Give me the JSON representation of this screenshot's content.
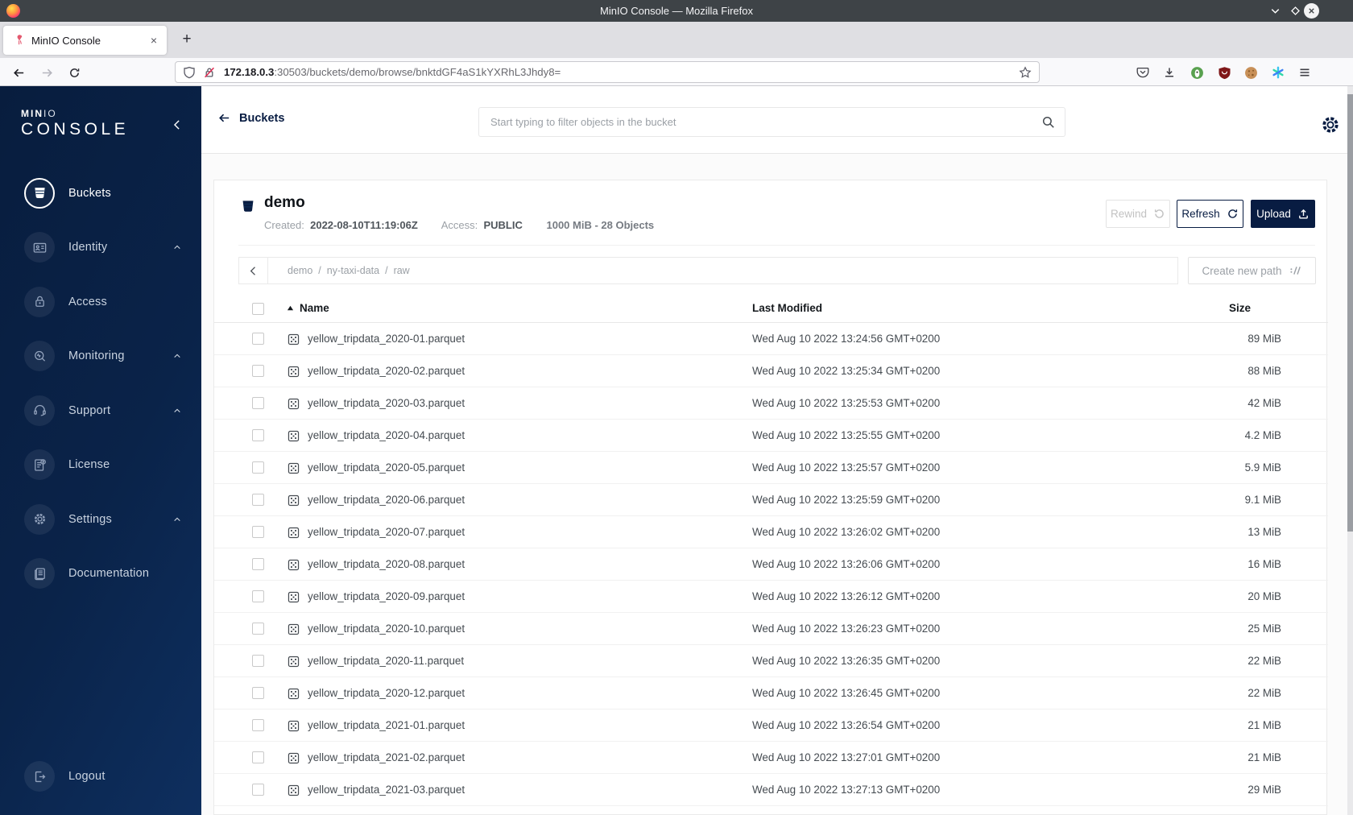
{
  "browser": {
    "window_title": "MinIO Console — Mozilla Firefox",
    "tab_title": "MinIO Console",
    "new_tab_label": "+",
    "tab_close_label": "×",
    "url_host": "172.18.0.3",
    "url_rest": ":30503/buckets/demo/browse/bnktdGF4aS1kYXRhL3Jhdy8="
  },
  "sidebar": {
    "logo_bold": "MIN",
    "logo_light": "IO",
    "logo_word": "CONSOLE",
    "items": [
      {
        "label": "Buckets",
        "icon": "bucket-icon",
        "active": true,
        "expandable": false
      },
      {
        "label": "Identity",
        "icon": "identity-icon",
        "active": false,
        "expandable": true
      },
      {
        "label": "Access",
        "icon": "lock-icon",
        "active": false,
        "expandable": false
      },
      {
        "label": "Monitoring",
        "icon": "monitoring-icon",
        "active": false,
        "expandable": true
      },
      {
        "label": "Support",
        "icon": "support-icon",
        "active": false,
        "expandable": true
      },
      {
        "label": "License",
        "icon": "license-icon",
        "active": false,
        "expandable": false
      },
      {
        "label": "Settings",
        "icon": "settings-icon",
        "active": false,
        "expandable": true
      },
      {
        "label": "Documentation",
        "icon": "documentation-icon",
        "active": false,
        "expandable": false
      }
    ],
    "logout_label": "Logout"
  },
  "topbar": {
    "back_label": "Buckets",
    "search_placeholder": "Start typing to filter objects in the bucket"
  },
  "bucket": {
    "name": "demo",
    "created_label": "Created:",
    "created_value": "2022-08-10T11:19:06Z",
    "access_label": "Access:",
    "access_value": "PUBLIC",
    "usage": "1000 MiB - 28 Objects",
    "rewind_label": "Rewind",
    "refresh_label": "Refresh",
    "upload_label": "Upload"
  },
  "browse": {
    "breadcrumb": [
      "demo",
      "ny-taxi-data",
      "raw"
    ],
    "path_separator": "/",
    "create_path_label": "Create new path",
    "columns": {
      "name": "Name",
      "modified": "Last Modified",
      "size": "Size"
    },
    "rows": [
      {
        "name": "yellow_tripdata_2020-01.parquet",
        "modified": "Wed Aug 10 2022 13:24:56 GMT+0200",
        "size": "89 MiB"
      },
      {
        "name": "yellow_tripdata_2020-02.parquet",
        "modified": "Wed Aug 10 2022 13:25:34 GMT+0200",
        "size": "88 MiB"
      },
      {
        "name": "yellow_tripdata_2020-03.parquet",
        "modified": "Wed Aug 10 2022 13:25:53 GMT+0200",
        "size": "42 MiB"
      },
      {
        "name": "yellow_tripdata_2020-04.parquet",
        "modified": "Wed Aug 10 2022 13:25:55 GMT+0200",
        "size": "4.2 MiB"
      },
      {
        "name": "yellow_tripdata_2020-05.parquet",
        "modified": "Wed Aug 10 2022 13:25:57 GMT+0200",
        "size": "5.9 MiB"
      },
      {
        "name": "yellow_tripdata_2020-06.parquet",
        "modified": "Wed Aug 10 2022 13:25:59 GMT+0200",
        "size": "9.1 MiB"
      },
      {
        "name": "yellow_tripdata_2020-07.parquet",
        "modified": "Wed Aug 10 2022 13:26:02 GMT+0200",
        "size": "13 MiB"
      },
      {
        "name": "yellow_tripdata_2020-08.parquet",
        "modified": "Wed Aug 10 2022 13:26:06 GMT+0200",
        "size": "16 MiB"
      },
      {
        "name": "yellow_tripdata_2020-09.parquet",
        "modified": "Wed Aug 10 2022 13:26:12 GMT+0200",
        "size": "20 MiB"
      },
      {
        "name": "yellow_tripdata_2020-10.parquet",
        "modified": "Wed Aug 10 2022 13:26:23 GMT+0200",
        "size": "25 MiB"
      },
      {
        "name": "yellow_tripdata_2020-11.parquet",
        "modified": "Wed Aug 10 2022 13:26:35 GMT+0200",
        "size": "22 MiB"
      },
      {
        "name": "yellow_tripdata_2020-12.parquet",
        "modified": "Wed Aug 10 2022 13:26:45 GMT+0200",
        "size": "22 MiB"
      },
      {
        "name": "yellow_tripdata_2021-01.parquet",
        "modified": "Wed Aug 10 2022 13:26:54 GMT+0200",
        "size": "21 MiB"
      },
      {
        "name": "yellow_tripdata_2021-02.parquet",
        "modified": "Wed Aug 10 2022 13:27:01 GMT+0200",
        "size": "21 MiB"
      },
      {
        "name": "yellow_tripdata_2021-03.parquet",
        "modified": "Wed Aug 10 2022 13:27:13 GMT+0200",
        "size": "29 MiB"
      }
    ]
  },
  "colors": {
    "accent_navy": "#081C42"
  }
}
